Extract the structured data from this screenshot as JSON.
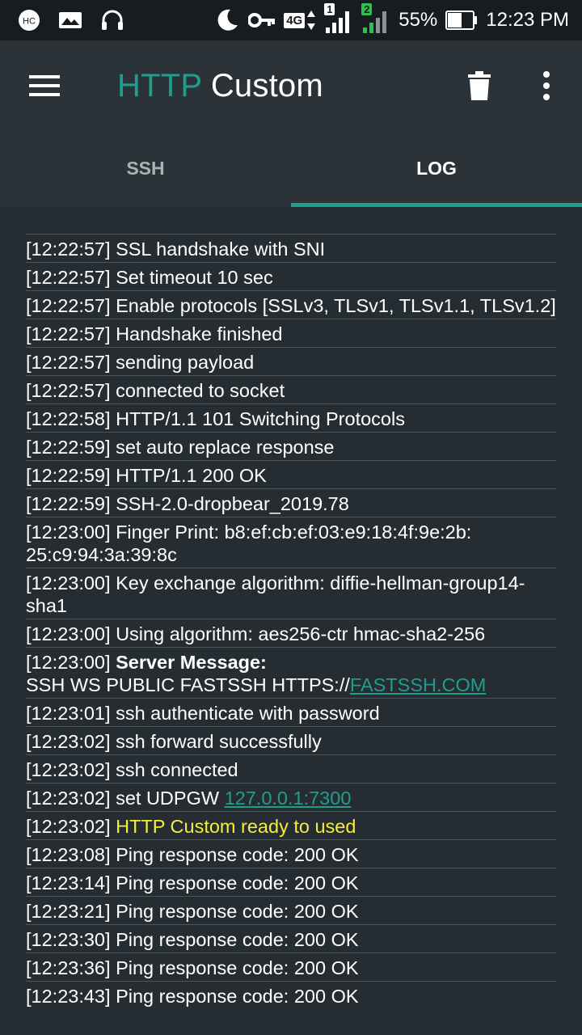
{
  "status_bar": {
    "hc_icon_text": "HC",
    "lte_label": "4G",
    "sim1_label": "1",
    "sim2_label": "2",
    "battery_percent": "55%",
    "time": "12:23 PM",
    "colors": {
      "sim2": "#2fbf4f",
      "background": "#171c20"
    }
  },
  "app_bar": {
    "title_part1": "HTTP",
    "title_part2": "Custom",
    "colors": {
      "accent": "#1e9e8f",
      "background": "#2b3338"
    }
  },
  "tabs": [
    {
      "label": "SSH",
      "active": false
    },
    {
      "label": "LOG",
      "active": true
    }
  ],
  "log": [
    {
      "ts": "[12:22:57]",
      "text": "SSL handshake with SNI"
    },
    {
      "ts": "[12:22:57]",
      "text": "Set timeout 10 sec"
    },
    {
      "ts": "[12:22:57]",
      "text": "Enable protocols [SSLv3, TLSv1, TLSv1.1, TLSv1.2]"
    },
    {
      "ts": "[12:22:57]",
      "text": "Handshake finished"
    },
    {
      "ts": "[12:22:57]",
      "text": "sending payload"
    },
    {
      "ts": "[12:22:57]",
      "text": "connected to socket"
    },
    {
      "ts": "[12:22:58]",
      "text": "HTTP/1.1 101 Switching Protocols"
    },
    {
      "ts": "[12:22:59]",
      "text": "set auto replace response"
    },
    {
      "ts": "[12:22:59]",
      "text": "HTTP/1.1 200 OK"
    },
    {
      "ts": "[12:22:59]",
      "text": "SSH-2.0-dropbear_2019.78"
    },
    {
      "ts": "[12:23:00]",
      "text": "Finger Print: b8:ef:cb:ef:03:e9:18:4f:9e:2b:",
      "text2": "25:c9:94:3a:39:8c"
    },
    {
      "ts": "[12:23:00]",
      "text": "Key exchange algorithm: diffie-hellman-group14-",
      "text2": "sha1"
    },
    {
      "ts": "[12:23:00]",
      "text": "Using algorithm: aes256-ctr hmac-sha2-256"
    },
    {
      "ts": "[12:23:00]",
      "bold": "Server Message:",
      "prefix2": "SSH WS PUBLIC FASTSSH HTTPS://",
      "link": "FASTSSH.COM"
    },
    {
      "ts": "[12:23:01]",
      "text": "ssh authenticate with password"
    },
    {
      "ts": "[12:23:02]",
      "text": "ssh forward successfully"
    },
    {
      "ts": "[12:23:02]",
      "text": "ssh connected"
    },
    {
      "ts": "[12:23:02]",
      "text": "set UDPGW",
      "link": "127.0.0.1:7300"
    },
    {
      "ts": "[12:23:02]",
      "yellow": "HTTP Custom ready to used"
    },
    {
      "ts": "[12:23:08]",
      "text": "Ping response code: 200 OK"
    },
    {
      "ts": "[12:23:14]",
      "text": "Ping response code: 200 OK"
    },
    {
      "ts": "[12:23:21]",
      "text": "Ping response code: 200 OK"
    },
    {
      "ts": "[12:23:30]",
      "text": "Ping response code: 200 OK"
    },
    {
      "ts": "[12:23:36]",
      "text": "Ping response code: 200 OK"
    },
    {
      "ts": "[12:23:43]",
      "text": "Ping response code: 200 OK"
    }
  ],
  "colors": {
    "link": "#1e9e8f",
    "highlight": "#f6ec3b",
    "page_background": "#262d32",
    "divider": "#4a5358"
  }
}
